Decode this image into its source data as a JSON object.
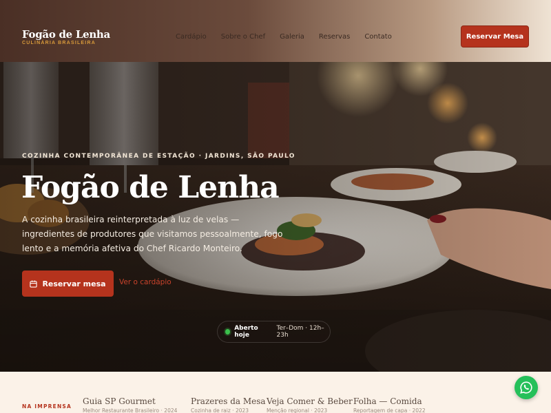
{
  "header": {
    "brand_name": "Fogão de Lenha",
    "brand_tagline": "CULINÁRIA BRASILEIRA",
    "nav": [
      "Cardápio",
      "Sobre o Chef",
      "Galeria",
      "Reservas",
      "Contato"
    ],
    "cta_label": "Reservar Mesa"
  },
  "hero": {
    "eyebrow": "COZINHA CONTEMPORÂNEA DE ESTAÇÃO · JARDINS, SÃO PAULO",
    "title": "Fogão de Lenha",
    "description": "A cozinha brasileira reinterpretada à luz de velas — ingredientes de produtores que visitamos pessoalmente, fogo lento e a memória afetiva do Chef Ricardo Monteiro.",
    "primary_cta": "Reservar mesa",
    "secondary_cta": "Ver o cardápio",
    "status_open": "Aberto hoje",
    "status_hours": "Ter–Dom · 12h–23h"
  },
  "press": {
    "label": "NA IMPRENSA",
    "items": [
      {
        "name": "Guia SP Gourmet",
        "meta": "Melhor Restaurante Brasileiro · 2024"
      },
      {
        "name": "Prazeres da Mesa",
        "meta": "Cozinha de raiz · 2023"
      },
      {
        "name": "Veja Comer & Beber",
        "meta": "Menção regional · 2023"
      },
      {
        "name": "Folha — Comida",
        "meta": "Reportagem de capa · 2022"
      }
    ]
  },
  "colors": {
    "accent": "#b5331d",
    "gold": "#d89a3a",
    "whatsapp": "#25c05a",
    "status_green": "#3bbf4c"
  },
  "icons": {
    "calendar": "calendar-icon",
    "whatsapp": "whatsapp-icon",
    "status": "status-dot-icon"
  }
}
